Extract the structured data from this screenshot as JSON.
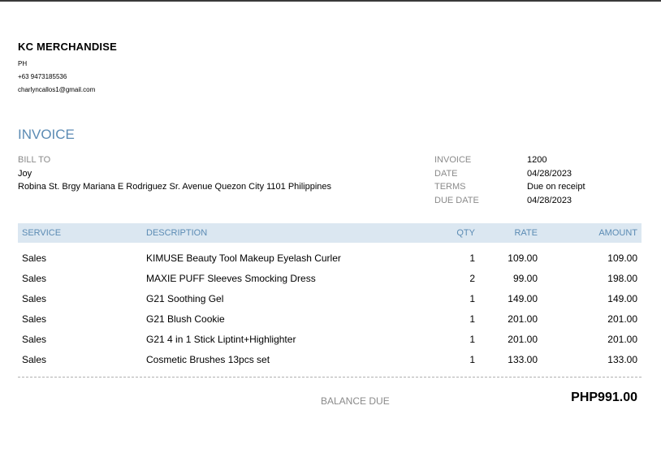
{
  "company": {
    "name": "KC MERCHANDISE",
    "country": "PH",
    "phone": "+63 9473185536",
    "email": "charlyncallos1@gmail.com"
  },
  "invoice_title": "INVOICE",
  "bill_to": {
    "label": "BILL TO",
    "name": "Joy",
    "address": "Robina St. Brgy Mariana E Rodriguez Sr. Avenue Quezon City 1101 Philippines"
  },
  "meta": [
    {
      "label": "INVOICE",
      "value": "1200"
    },
    {
      "label": "DATE",
      "value": "04/28/2023"
    },
    {
      "label": "TERMS",
      "value": "Due on receipt"
    },
    {
      "label": "DUE DATE",
      "value": "04/28/2023"
    }
  ],
  "table": {
    "headers": {
      "service": "SERVICE",
      "description": "DESCRIPTION",
      "qty": "QTY",
      "rate": "RATE",
      "amount": "AMOUNT"
    },
    "rows": [
      {
        "service": "Sales",
        "description": "KIMUSE Beauty Tool Makeup Eyelash Curler",
        "qty": "1",
        "rate": "109.00",
        "amount": "109.00"
      },
      {
        "service": "Sales",
        "description": "MAXIE PUFF Sleeves Smocking Dress",
        "qty": "2",
        "rate": "99.00",
        "amount": "198.00"
      },
      {
        "service": "Sales",
        "description": "G21 Soothing Gel",
        "qty": "1",
        "rate": "149.00",
        "amount": "149.00"
      },
      {
        "service": "Sales",
        "description": "G21 Blush Cookie",
        "qty": "1",
        "rate": "201.00",
        "amount": "201.00"
      },
      {
        "service": "Sales",
        "description": "G21 4 in 1 Stick Liptint+Highlighter",
        "qty": "1",
        "rate": "201.00",
        "amount": "201.00"
      },
      {
        "service": "Sales",
        "description": "Cosmetic Brushes 13pcs set",
        "qty": "1",
        "rate": "133.00",
        "amount": "133.00"
      }
    ]
  },
  "balance": {
    "label": "BALANCE DUE",
    "value": "PHP991.00"
  },
  "colors": {
    "accent": "#5b8bb4",
    "header_bg": "#dbe7f1",
    "muted": "#8a8a8a"
  }
}
